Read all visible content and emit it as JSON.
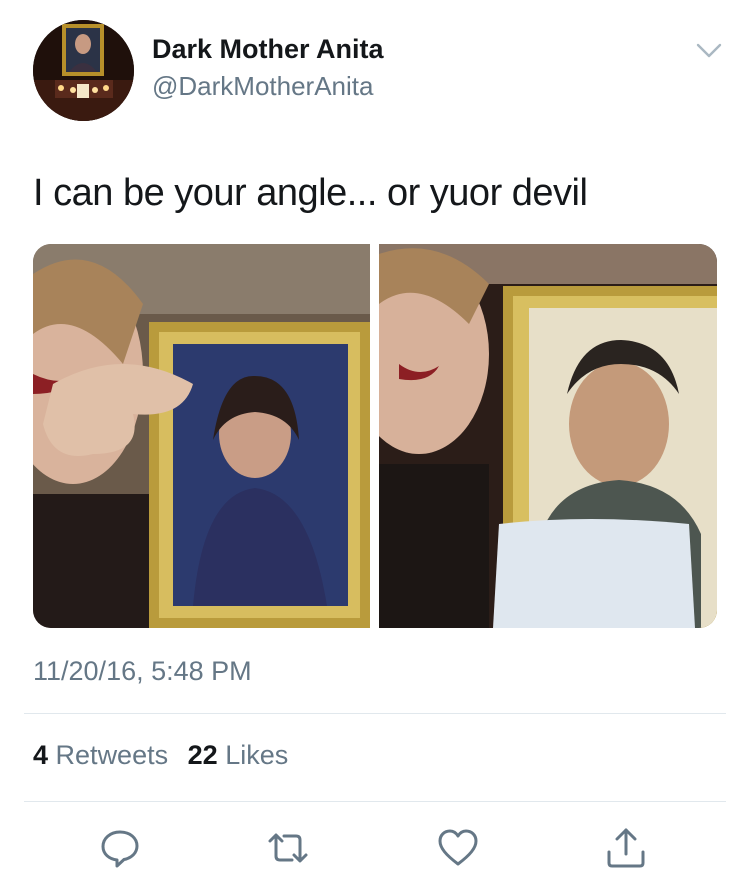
{
  "user": {
    "display_name": "Dark Mother Anita",
    "handle": "@DarkMotherAnita",
    "avatar_icon": "avatar-altar-portrait"
  },
  "tweet": {
    "text": "I can be your angle... or yuor devil",
    "timestamp": "11/20/16, 5:48 PM"
  },
  "media": {
    "photos": [
      {
        "id": "photo-1",
        "icon": "photo-framed-portrait-woman"
      },
      {
        "id": "photo-2",
        "icon": "photo-framed-portrait-man"
      }
    ]
  },
  "stats": {
    "retweets_count": "4",
    "retweets_label": "Retweets",
    "likes_count": "22",
    "likes_label": "Likes"
  },
  "actions": [
    {
      "name": "reply",
      "icon": "reply-icon"
    },
    {
      "name": "retweet",
      "icon": "retweet-icon"
    },
    {
      "name": "like",
      "icon": "heart-icon"
    },
    {
      "name": "share",
      "icon": "share-icon"
    }
  ],
  "colors": {
    "text_primary": "#14171a",
    "text_secondary": "#657786",
    "divider": "#e1e8ed",
    "icon": "#657786"
  }
}
